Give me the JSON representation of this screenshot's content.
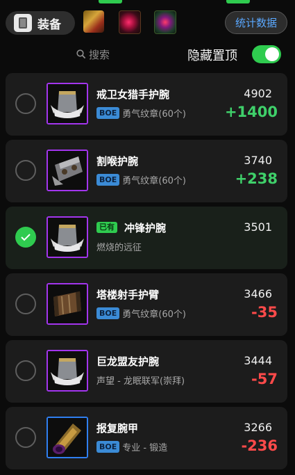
{
  "header": {
    "equip_label": "装备",
    "stats_label": "统计数据",
    "icons": [
      "armor-icon",
      "weapon-icon",
      "gem-red-icon",
      "gem-green-icon"
    ]
  },
  "search": {
    "placeholder": "搜索"
  },
  "toggle": {
    "label": "隐藏置顶",
    "on": true
  },
  "colors": {
    "epic": "#a335ee",
    "rare": "#2f7ff0",
    "accent": "#2fcb4f",
    "positive": "#3fd06a",
    "negative": "#ff4a4a",
    "boe": "#3b8bd6"
  },
  "items": [
    {
      "name": "戒卫女猎手护腕",
      "boe": "BOE",
      "source": "勇气纹章(60个)",
      "score": "4902",
      "delta": "+1400",
      "quality": "epic-icon",
      "owned": false
    },
    {
      "name": "割喉护腕",
      "boe": "BOE",
      "source": "勇气纹章(60个)",
      "score": "3740",
      "delta": "+238",
      "quality": "epic-icon",
      "owned": false
    },
    {
      "name": "冲锋护腕",
      "owned_badge": "已有",
      "source": "燃烧的远征",
      "score": "3501",
      "delta": "",
      "quality": "epic-icon",
      "owned": true
    },
    {
      "name": "塔楼射手护臂",
      "boe": "BOE",
      "source": "勇气纹章(60个)",
      "score": "3466",
      "delta": "-35",
      "quality": "epic-icon",
      "owned": false
    },
    {
      "name": "巨龙盟友护腕",
      "source": "声望 - 龙眠联军(崇拜)",
      "score": "3444",
      "delta": "-57",
      "quality": "epic-icon",
      "owned": false
    },
    {
      "name": "报复腕甲",
      "boe": "BOE",
      "source": "专业 - 锻造",
      "score": "3266",
      "delta": "-236",
      "quality": "rare-icon",
      "owned": false
    }
  ]
}
